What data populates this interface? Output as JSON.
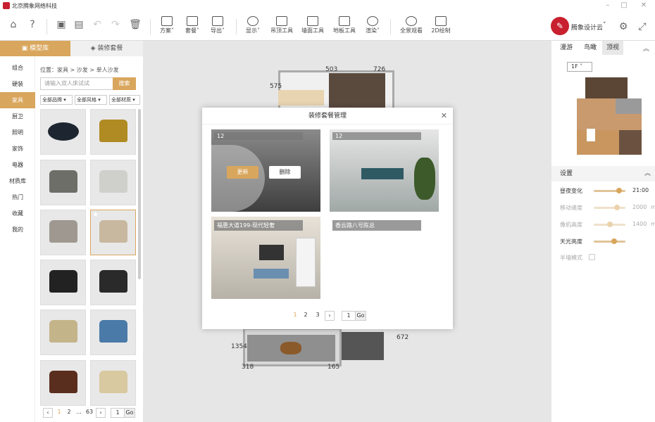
{
  "titlebar": {
    "title": "北京腾象网络科技"
  },
  "toolbar": {
    "items": [
      {
        "label": "方案"
      },
      {
        "label": "套餐"
      },
      {
        "label": "导出"
      },
      {
        "label": "显示"
      },
      {
        "label": "吊顶工具"
      },
      {
        "label": "墙面工具"
      },
      {
        "label": "地板工具"
      },
      {
        "label": "渲染"
      },
      {
        "label": "全景观看"
      },
      {
        "label": "2D绘制"
      }
    ],
    "brand": "腾象设计云"
  },
  "left_panel": {
    "tabs": [
      "模型库",
      "装修套餐"
    ],
    "categories": [
      "组合",
      "硬装",
      "家具",
      "厨卫",
      "照明",
      "家饰",
      "电器",
      "材质库",
      "热门",
      "收藏",
      "我的"
    ],
    "active_category": "家具",
    "breadcrumb": "位置：家具 > 沙发 > 单人沙发",
    "search": {
      "placeholder": "请输入双人床试试",
      "button": "搜索"
    },
    "filters": [
      "全部品牌 ▾",
      "全部风格 ▾",
      "全部材质 ▾"
    ],
    "pager": {
      "pages": [
        "1",
        "2",
        "...",
        "63"
      ],
      "input": "1",
      "go": "Go"
    }
  },
  "canvas": {
    "dims": [
      "503",
      "726",
      "575",
      "1354",
      "318",
      "165",
      "672"
    ]
  },
  "right_panel": {
    "view_tabs": [
      "漫游",
      "鸟瞰",
      "顶视"
    ],
    "active_view": "顶视",
    "floor": "1F",
    "settings_title": "设置",
    "settings": [
      {
        "label": "昼夜变化",
        "value": "21:00",
        "level": 0.8,
        "enabled": true
      },
      {
        "label": "移动速度",
        "value": "2000",
        "unit": "mm",
        "level": 0.7,
        "enabled": false
      },
      {
        "label": "像机高度",
        "value": "1400",
        "unit": "mm",
        "level": 0.5,
        "enabled": false
      },
      {
        "label": "天光亮度",
        "value": "",
        "level": 0.65,
        "enabled": true
      }
    ],
    "half_wall": "半墙模式"
  },
  "modal": {
    "title": "装修套餐管理",
    "cards": [
      {
        "badge": "12",
        "caption": "",
        "actions": [
          "更新",
          "删除"
        ]
      },
      {
        "badge": "12",
        "caption": ""
      },
      {
        "badge": "",
        "caption": "福惠大道199-现代轻奢"
      },
      {
        "badge": "",
        "caption": "香云路八号陈总"
      }
    ],
    "pager": {
      "pages": [
        "1",
        "2",
        "3"
      ],
      "input": "1",
      "go": "Go"
    }
  },
  "colors": {
    "accent": "#d9a65d",
    "brand": "#c8202e"
  }
}
